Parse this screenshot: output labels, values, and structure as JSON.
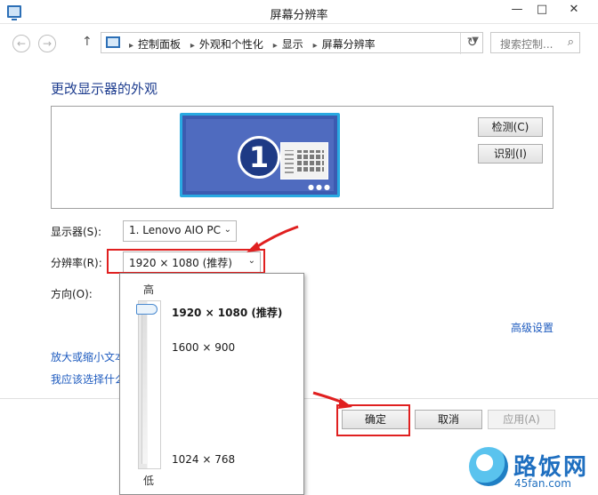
{
  "window": {
    "title": "屏幕分辨率",
    "min": "—",
    "max": "□",
    "close": "✕"
  },
  "nav": {
    "back_icon": "arrow-left",
    "forward_icon": "arrow-right",
    "up_icon": "arrow-up",
    "breadcrumbs": [
      "控制面板",
      "外观和个性化",
      "显示",
      "屏幕分辨率"
    ],
    "search_placeholder": "搜索控制..."
  },
  "main": {
    "heading": "更改显示器的外观",
    "monitor_number": "1",
    "detect_label": "检测(C)",
    "identify_label": "识别(I)",
    "display_label": "显示器(S):",
    "display_value": "1. Lenovo AIO PC",
    "resolution_label": "分辨率(R):",
    "resolution_value": "1920 × 1080 (推荐)",
    "orientation_label": "方向(O):",
    "advanced_link": "高级设置",
    "enlarge_link": "放大或缩小文本",
    "which_link": "我应该选择什么"
  },
  "footer": {
    "ok_label": "确定",
    "cancel_label": "取消",
    "apply_label": "应用(A)"
  },
  "slider": {
    "high_label": "高",
    "low_label": "低",
    "options": [
      "1920 × 1080 (推荐)",
      "1600 × 900",
      "1024 × 768"
    ],
    "selected_index": 0
  },
  "watermark": {
    "name": "路饭网",
    "url": "45fan.com"
  },
  "colors": {
    "accent": "#1e5bbf",
    "highlight": "#e02020",
    "monitor": "#3c5bb0"
  }
}
